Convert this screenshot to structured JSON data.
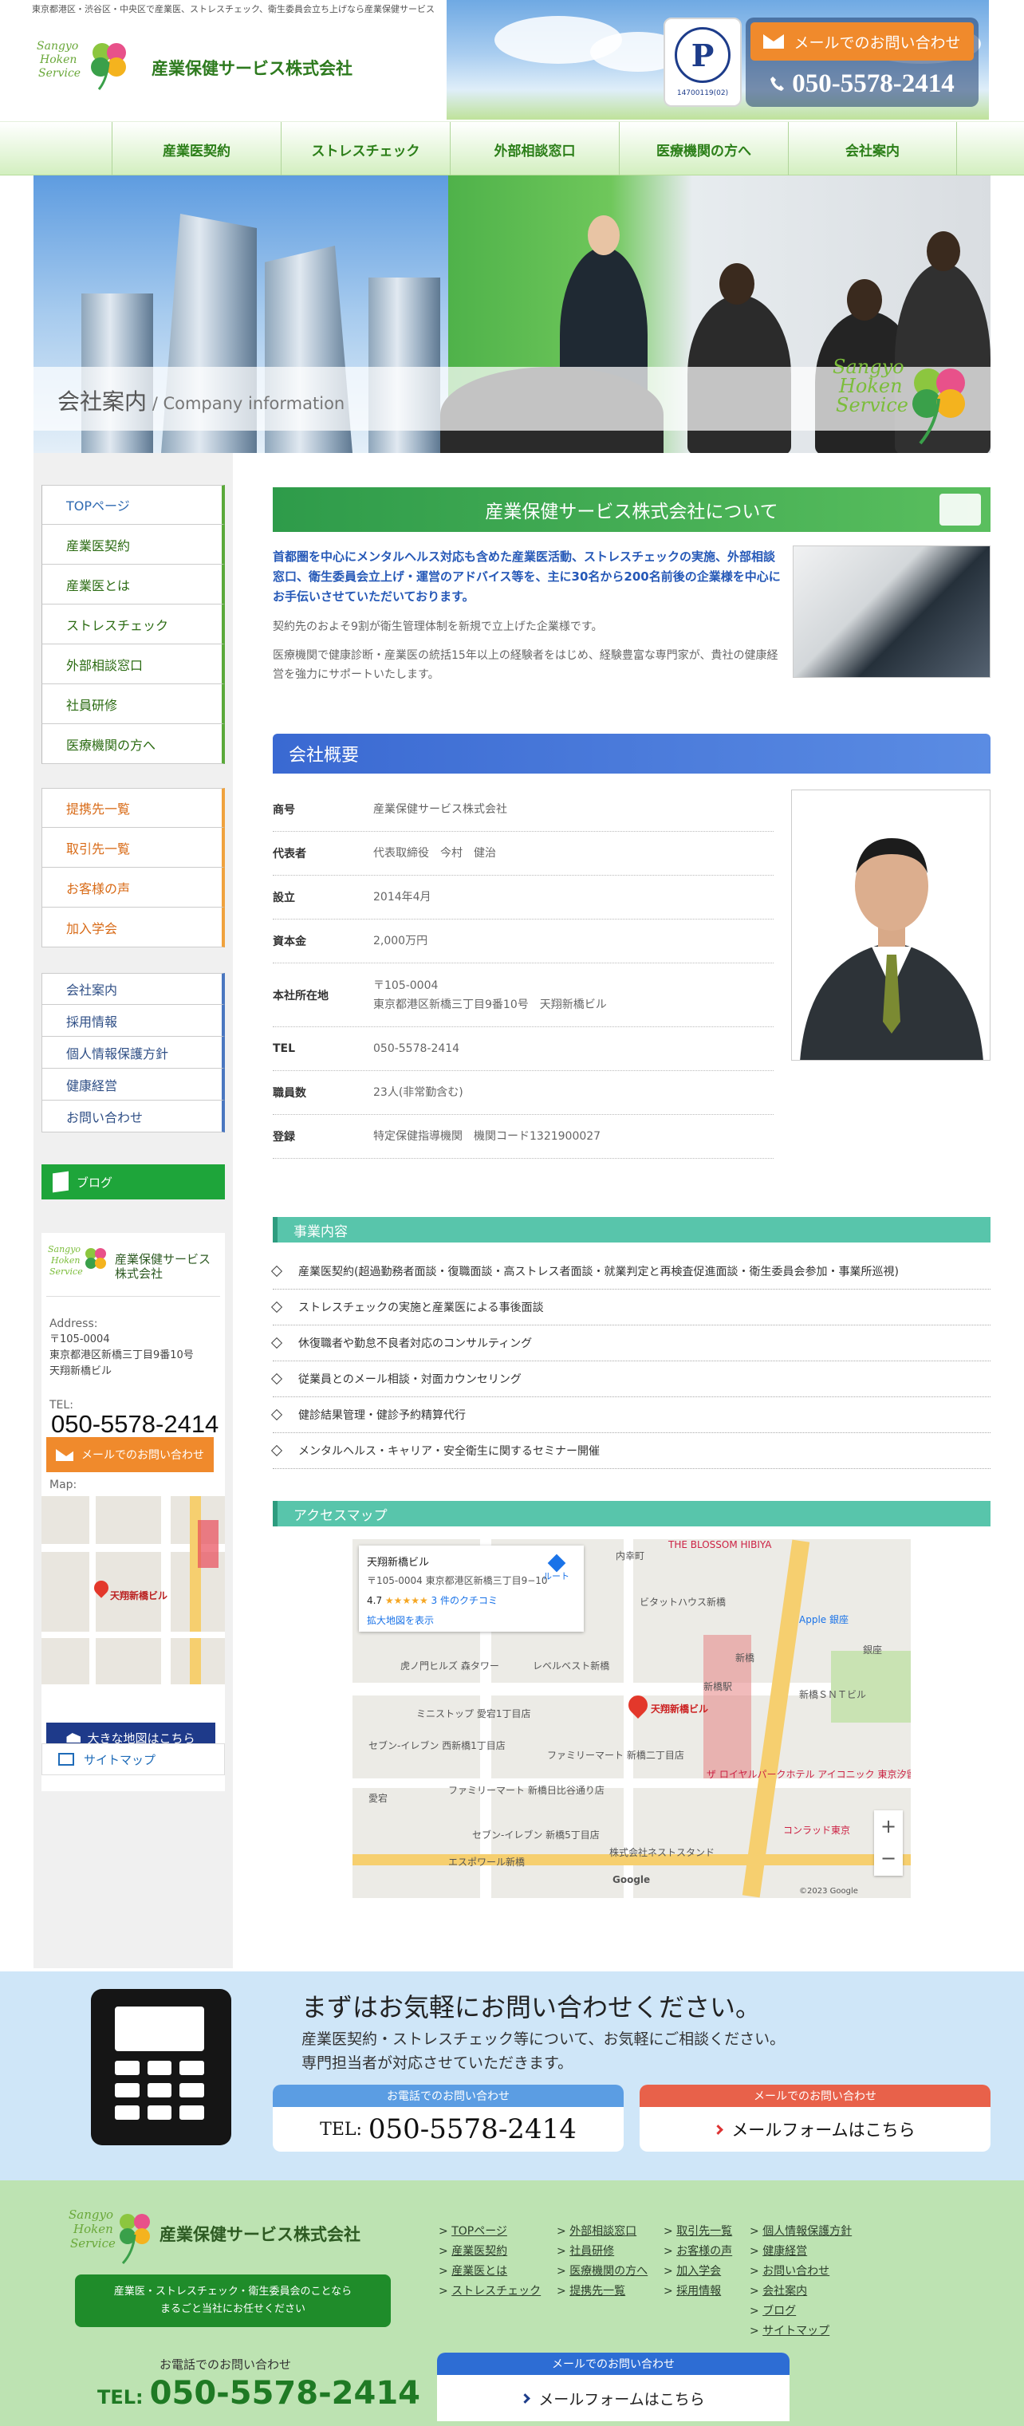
{
  "header": {
    "topnote": "東京都港区・渋谷区・中央区で産業医、ストレスチェック、衛生委員会立ち上げなら産業保健サービス",
    "logo_en_1": "Sangyo",
    "logo_en_2": "Hoken",
    "logo_en_3": "Service",
    "company": "産業保健サービス株式会社",
    "pmark_letter": "P",
    "pmark_num": "14700119(02)",
    "mail_button": "メールでのお問い合わせ",
    "tel": "050-5578-2414"
  },
  "nav": [
    "産業医契約",
    "ストレスチェック",
    "外部相談窓口",
    "医療機関の方へ",
    "会社案内"
  ],
  "hero": {
    "title": "会社案内",
    "subtitle": " / Company information"
  },
  "sidebar": {
    "green_items": [
      "TOPページ",
      "産業医契約",
      "産業医とは",
      "ストレスチェック",
      "外部相談窓口",
      "社員研修",
      "医療機関の方へ"
    ],
    "orange_items": [
      "提携先一覧",
      "取引先一覧",
      "お客様の声",
      "加入学会"
    ],
    "blue_items": [
      "会社案内",
      "採用情報",
      "個人情報保護方針",
      "健康経営",
      "お問い合わせ"
    ],
    "blog": "ブログ",
    "company": "産業保健サービス株式会社",
    "address_label": "Address:",
    "zip": "〒105-0004",
    "address1": "東京都港区新橋三丁目9番10号",
    "address2": "天翔新橋ビル",
    "tel_label": "TEL:",
    "tel": "050-5578-2414",
    "mail_button": "メールでのお問い合わせ",
    "map_label": "Map:",
    "map_place": "天翔新橋ビル",
    "bigmap": "大きな地図はこちら",
    "sitemap": "サイトマップ"
  },
  "about": {
    "heading": "産業保健サービス株式会社について",
    "lead": "首都圏を中心にメンタルヘルス対応も含めた産業医活動、ストレスチェックの実施、外部相談窓口、衛生委員会立上げ・運営のアドバイス等を、主に30名から200名前後の企業様を中心にお手伝いさせていただいております。",
    "p1": "契約先のおよそ9割が衛生管理体制を新規で立上げた企業様です。",
    "p2": "医療機関で健康診断・産業医の統括15年以上の経験者をはじめ、経験豊富な専門家が、貴社の健康経営を強力にサポートいたします。"
  },
  "profile": {
    "heading": "会社概要",
    "rows": [
      {
        "k": "商号",
        "v": "産業保健サービス株式会社"
      },
      {
        "k": "代表者",
        "v": "代表取締役　今村　健治"
      },
      {
        "k": "設立",
        "v": "2014年4月"
      },
      {
        "k": "資本金",
        "v": "2,000万円"
      },
      {
        "k": "本社所在地",
        "v": "〒105-0004",
        "v2": "東京都港区新橋三丁目9番10号　天翔新橋ビル"
      },
      {
        "k": "TEL",
        "v": "050-5578-2414"
      },
      {
        "k": "職員数",
        "v": "23人(非常勤含む)"
      },
      {
        "k": "登録",
        "v": "特定保健指導機関　機関コード1321900027"
      }
    ]
  },
  "business": {
    "heading": "事業内容",
    "items": [
      "産業医契約(超過勤務者面談・復職面談・高ストレス者面談・就業判定と再検査促進面談・衛生委員会参加・事業所巡視)",
      "ストレスチェックの実施と産業医による事後面談",
      "休復職者や勤怠不良者対応のコンサルティング",
      "従業員とのメール相談・対面カウンセリング",
      "健診結果管理・健診予約精算代行",
      "メンタルヘルス・キャリア・安全衛生に関するセミナー開催"
    ]
  },
  "access": {
    "heading": "アクセスマップ",
    "card_name": "天翔新橋ビル",
    "card_addr": "〒105-0004 東京都港区新橋三丁目9−10",
    "rating": "4.7",
    "stars": "★★★★★",
    "reviews": "3 件のクチコミ",
    "larger": "拡大地図を表示",
    "route": "ルート",
    "labels": [
      "内幸町",
      "THE BLOSSOM HIBIYA",
      "ビタットハウス新橋",
      "Apple 銀座",
      "銀座",
      "新橋",
      "新橋ＳＮＴビル",
      "ミニストップ 愛宕1丁目店",
      "虎ノ門ヒルズ 森タワー",
      "レベルベスト新橋",
      "新橋駅",
      "セブン-イレブン 西新橋1丁目店",
      "ファミリーマート 新橋二丁目店",
      "愛宕",
      "ファミリーマート 新橋日比谷通り店",
      "セブン-イレブン 新橋5丁目店",
      "エスポワール新橋",
      "株式会社ネストスタンド",
      "コンラッド東京",
      "ザ ロイヤルパークホテル アイコニック 東京汐留",
      "Google",
      "©2023 Google"
    ],
    "pin_label": "天翔新橋ビル"
  },
  "contact": {
    "title": "まずはお気軽にお問い合わせください。",
    "sub1": "産業医契約・ストレスチェック等について、お気軽にご相談ください。",
    "sub2": "専門担当者が対応させていただきます。",
    "tel_caption": "お電話でのお問い合わせ",
    "tel_prefix": "TEL:",
    "tel": "050-5578-2414",
    "mail_caption": "メールでのお問い合わせ",
    "mail_text": "メールフォームはこちら",
    "tel_caption_color": "#5b9de3",
    "mail_caption_color": "#e8614a"
  },
  "footer": {
    "company": "産業保健サービス株式会社",
    "tagline1": "産業医・ストレスチェック・衛生委員会のことなら",
    "tagline2": "まるごと当社にお任せください",
    "tel_label": "お電話でのお問い合わせ",
    "tel_prefix": "TEL:",
    "tel": "050-5578-2414",
    "col1": [
      "TOPページ",
      "産業医契約",
      "産業医とは",
      "ストレスチェック"
    ],
    "col2": [
      "外部相談窓口",
      "社員研修",
      "医療機関の方へ",
      "提携先一覧"
    ],
    "col3": [
      "取引先一覧",
      "お客様の声",
      "加入学会",
      "採用情報"
    ],
    "col4": [
      "個人情報保護方針",
      "健康経営",
      "お問い合わせ",
      "会社案内",
      "ブログ",
      "サイトマップ"
    ],
    "mail_caption": "メールでのお問い合わせ",
    "mail_text": "メールフォームはこちら"
  }
}
